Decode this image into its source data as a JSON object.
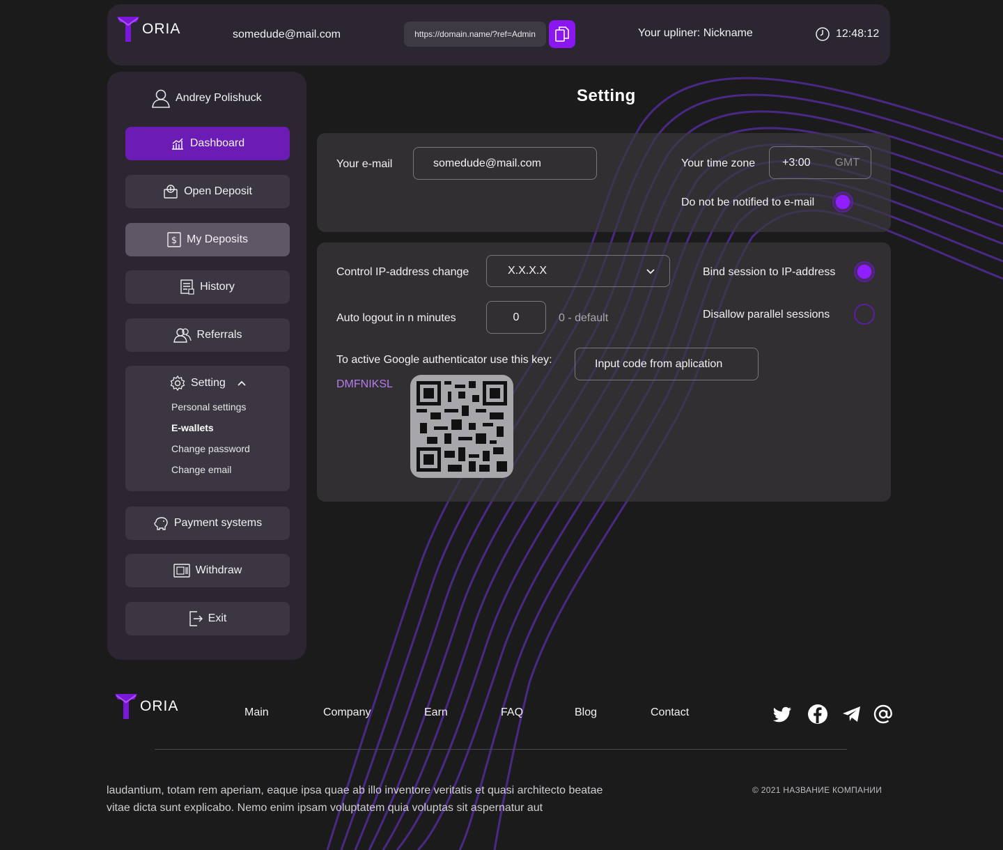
{
  "brand": {
    "logo_text": "ORIA",
    "accent": "#8a16f0"
  },
  "header": {
    "email": "somedude@mail.com",
    "ref_link": "https://domain.name/?ref=Admin",
    "upliner": "Your upliner: Nickname",
    "time": "12:48:12"
  },
  "sidebar": {
    "user_name": "Andrey Polishuck",
    "items": {
      "dashboard": "Dashboard",
      "open_deposit": "Open Deposit",
      "my_deposits": "My Deposits",
      "history": "History",
      "referrals": "Referrals",
      "setting": "Setting",
      "payment_systems": "Payment systems",
      "withdraw": "Withdraw",
      "exit": "Exit"
    },
    "setting_sub": {
      "personal": "Personal settings",
      "ewallets": "E-wallets",
      "change_password": "Change password",
      "change_email": "Change email"
    }
  },
  "main": {
    "title": "Setting",
    "email_label": "Your e-mail",
    "email_value": "somedude@mail.com",
    "timezone_label": "Your time zone",
    "timezone_value": "+3:00",
    "timezone_suffix": "GMT",
    "notify_label": "Do not be notified to e-mail",
    "notify_on": true,
    "ip_label": "Control IP-address change",
    "ip_value": "X.X.X.X",
    "bind_label": "Bind session to IP-address",
    "bind_on": true,
    "logout_label": "Auto logout in n minutes",
    "logout_value": "0",
    "logout_hint": "0 - default",
    "parallel_label": "Disallow parallel sessions",
    "parallel_on": false,
    "ga_label": "To active Google authenticator use this key:",
    "ga_key": "DMFNIKSL",
    "ga_placeholder": "Input code from aplication"
  },
  "footer": {
    "links": [
      "Main",
      "Company",
      "Earn",
      "FAQ",
      "Blog",
      "Contact"
    ],
    "text_line1": "laudantium, totam rem aperiam, eaque ipsa quae ab illo inventore veritatis et quasi architecto beatae",
    "text_line2": "vitae dicta sunt explicabo. Nemo enim ipsam voluptatem quia voluptas sit aspernatur aut",
    "copyright": "© 2021 НАЗВАНИЕ КОМПАНИИ",
    "social_icons": [
      "twitter-icon",
      "facebook-icon",
      "telegram-icon",
      "at-icon"
    ]
  }
}
